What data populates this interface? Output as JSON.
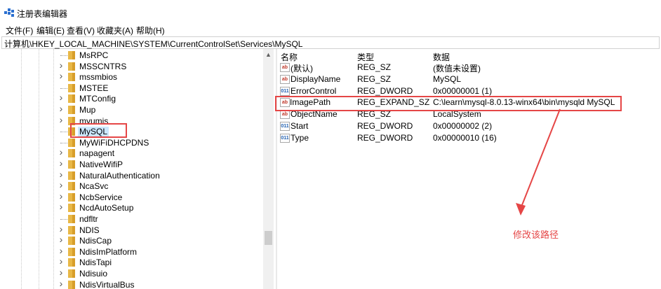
{
  "window": {
    "title": "注册表编辑器"
  },
  "menu": [
    "文件(F)",
    "编辑(E)",
    "查看(V)",
    "收藏夹(A)",
    "帮助(H)"
  ],
  "address": "计算机\\HKEY_LOCAL_MACHINE\\SYSTEM\\CurrentControlSet\\Services\\MySQL",
  "tree": {
    "items": [
      {
        "label": "MsRPC",
        "expandable": false
      },
      {
        "label": "MSSCNTRS",
        "expandable": true
      },
      {
        "label": "mssmbios",
        "expandable": true
      },
      {
        "label": "MSTEE",
        "expandable": false
      },
      {
        "label": "MTConfig",
        "expandable": true
      },
      {
        "label": "Mup",
        "expandable": true
      },
      {
        "label": "mvumis",
        "expandable": true
      },
      {
        "label": "MySQL",
        "expandable": false,
        "selected": true
      },
      {
        "label": "MyWiFiDHCPDNS",
        "expandable": false
      },
      {
        "label": "napagent",
        "expandable": true
      },
      {
        "label": "NativeWifiP",
        "expandable": true
      },
      {
        "label": "NaturalAuthentication",
        "expandable": true
      },
      {
        "label": "NcaSvc",
        "expandable": true
      },
      {
        "label": "NcbService",
        "expandable": true
      },
      {
        "label": "NcdAutoSetup",
        "expandable": true
      },
      {
        "label": "ndfltr",
        "expandable": false
      },
      {
        "label": "NDIS",
        "expandable": true
      },
      {
        "label": "NdisCap",
        "expandable": true
      },
      {
        "label": "NdisImPlatform",
        "expandable": true
      },
      {
        "label": "NdisTapi",
        "expandable": true
      },
      {
        "label": "Ndisuio",
        "expandable": true
      },
      {
        "label": "NdisVirtualBus",
        "expandable": true
      }
    ]
  },
  "values": {
    "headers": [
      "名称",
      "类型",
      "数据"
    ],
    "rows": [
      {
        "icon": "ab",
        "name": "(默认)",
        "type": "REG_SZ",
        "data": "(数值未设置)"
      },
      {
        "icon": "ab",
        "name": "DisplayName",
        "type": "REG_SZ",
        "data": "MySQL"
      },
      {
        "icon": "bin",
        "name": "ErrorControl",
        "type": "REG_DWORD",
        "data": "0x00000001 (1)"
      },
      {
        "icon": "ab",
        "name": "ImagePath",
        "type": "REG_EXPAND_SZ",
        "data": "C:\\learn\\mysql-8.0.13-winx64\\bin\\mysqld MySQL",
        "highlighted": true
      },
      {
        "icon": "ab",
        "name": "ObjectName",
        "type": "REG_SZ",
        "data": "LocalSystem"
      },
      {
        "icon": "bin",
        "name": "Start",
        "type": "REG_DWORD",
        "data": "0x00000002 (2)"
      },
      {
        "icon": "bin",
        "name": "Type",
        "type": "REG_DWORD",
        "data": "0x00000010 (16)"
      }
    ]
  },
  "annotation": {
    "text": "修改该路径",
    "color": "#e54646"
  },
  "colors": {
    "folder": "#e8b847",
    "selection": "#cce8ff",
    "accent_red": "#e54646"
  }
}
